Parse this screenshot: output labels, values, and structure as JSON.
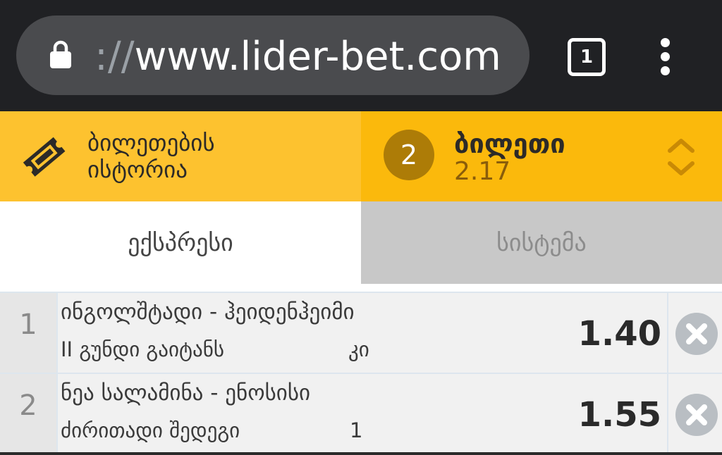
{
  "browser": {
    "url_scheme": "://",
    "url_host": "www.lider-bet.com",
    "tab_count": "1",
    "icons": [
      "lock-icon",
      "tab-switcher-icon",
      "overflow-menu-icon"
    ]
  },
  "header": {
    "history_label_line1": "ბილეთების",
    "history_label_line2": "ისტორია",
    "bet_count": "2",
    "betslip_title": "ბილეთი",
    "total_odds": "2.17"
  },
  "tabs": {
    "express": "ექსპრესი",
    "system": "სისტემა",
    "active": "express"
  },
  "bets": [
    {
      "index": "1",
      "match": "ინგოლშტადი - ჰეიდენჰეიმი",
      "market": "II გუნდი გაიტანს",
      "outcome": "კი",
      "odds": "1.40"
    },
    {
      "index": "2",
      "match": "ნეა სალამინა - ენოსისი",
      "market": "ძირითადი შედეგი",
      "outcome": "1",
      "odds": "1.55"
    }
  ],
  "colors": {
    "history_bg": "#fdc22f",
    "betslip_bg": "#fbb90c",
    "badge_bg": "#ad7c07",
    "chevron": "#c98a05"
  }
}
